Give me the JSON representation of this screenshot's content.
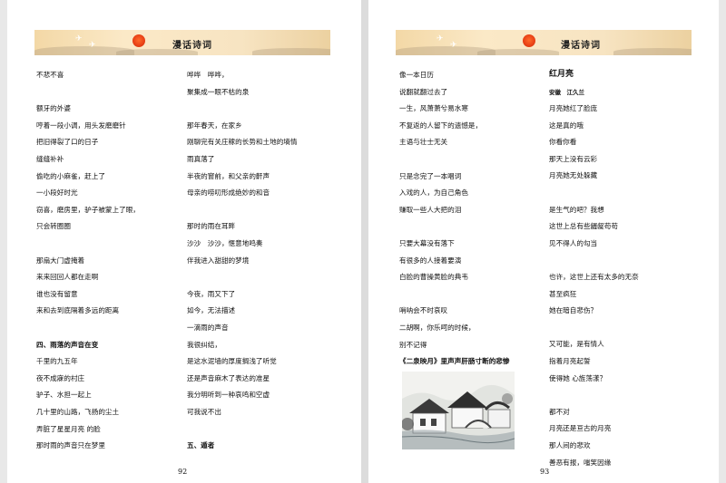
{
  "left_page": {
    "banner_title": "漫话诗词",
    "page_number": "92",
    "col1": [
      "不悲不喜",
      "",
      "额牙的外婆",
      "哼着一段小调，用头发磨磨针",
      "把旧得裂了口的日子",
      "缝缝补补",
      "偷吃的小麻雀，赶上了",
      "一小段好时光",
      "窃喜，磨房里，驴子被蒙上了眼，",
      "只会转圈圈",
      "",
      "那扇大门虚掩着",
      "来来回回人都在走啊",
      "谁也没有留意",
      "来和去到底隔着多远的距离",
      "",
      "四、雨落的声音在变",
      "千里的九五年",
      "夜不成寐的村庄",
      "驴子、水担一起上",
      "几十里的山路，飞扬的尘土",
      "弄脏了星星月亮 的脸",
      "那时雨的声音只在梦里"
    ],
    "col2": [
      "哗哗　哗哗，",
      "聚集成一眼不枯的泉",
      "",
      "那年春天，在家乡",
      "刚聊完有关庄稼的长势和土地的墒情",
      "雨真落了",
      "半夜的窗前，和父亲的鼾声",
      "母亲的唠叨形成绝妙的和音",
      "",
      "那时的雨在耳畔",
      "沙沙　沙沙，惬意地鸣奏",
      "伴我进入甜甜的梦境",
      "",
      "今夜，雨又下了",
      "如今，无法描述",
      "一滴雨的声音",
      "我很纠结，",
      "是这水泥墙的厚度搁浅了听觉",
      "还是声音麻木了表达的准星",
      "我分明听到一种哀鸣和空虚",
      "可我说不出",
      "",
      "五、遁者"
    ]
  },
  "right_page": {
    "banner_title": "漫话诗词",
    "page_number": "93",
    "col1": [
      "像一本日历",
      "说翻就翻过去了",
      "一生，风萧萧兮易水寒",
      "不复返的人留下的遗憾是，",
      "主语与壮士无关",
      "",
      "只是念完了一本唱词",
      "入戏的人，为自己角色",
      "赚取一些人大把的泪",
      "",
      "只要大幕没有落下",
      "有很多的人接着要演",
      "白脸的曹操黄脸的典韦",
      "",
      "哨呐会不时哀叹",
      "二胡啊，你乐呵的时候，",
      "别不记得",
      "《二泉映月》里声声肝肠寸断的悲惨"
    ],
    "col2_title": "红月亮",
    "col2_author": "安徽　江久兰",
    "col2": [
      "月亮她红了脸庞",
      "这是真的哦",
      "你看你看",
      "那天上没有云彩",
      "月亮她无处躲藏",
      "",
      "是生气的吧？我想",
      "这世上总有些龌龊苟苟",
      "见不得人的勾当",
      "",
      "也许，这世上还有太多的无奈",
      "甚至疯狂",
      "她在暗自悲伤？",
      "",
      "又可能，是有情人",
      "指着月亮起誓",
      "使得她 心旌荡漾？",
      "",
      "都不对",
      "月亮还是亘古的月亮",
      "那人间的悲欢",
      "善恶有报，嗤笑因缘"
    ]
  },
  "illustration": {
    "icon": "ink-painting-village"
  }
}
